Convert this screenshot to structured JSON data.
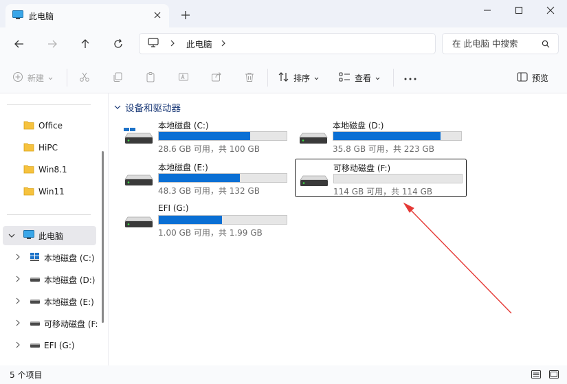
{
  "window": {
    "tab_title": "此电脑",
    "minimize_icon": "minimize-icon",
    "maximize_icon": "maximize-icon",
    "close_icon": "close-icon"
  },
  "address": {
    "crumb": "此电脑",
    "search_placeholder": "在 此电脑 中搜索"
  },
  "toolbar": {
    "new_label": "新建",
    "sort_label": "排序",
    "view_label": "查看",
    "preview_label": "预览"
  },
  "nav": {
    "items": [
      {
        "label": "Office",
        "icon": "folder-icon"
      },
      {
        "label": "HiPC",
        "icon": "folder-icon"
      },
      {
        "label": "Win8.1",
        "icon": "folder-icon"
      },
      {
        "label": "Win11",
        "icon": "folder-icon"
      },
      {
        "label": "此电脑",
        "icon": "pc-icon"
      },
      {
        "label": "本地磁盘 (C:)",
        "icon": "windows-drive-icon"
      },
      {
        "label": "本地磁盘 (D:)",
        "icon": "drive-icon"
      },
      {
        "label": "本地磁盘 (E:)",
        "icon": "drive-icon"
      },
      {
        "label": "可移动磁盘 (F:",
        "icon": "drive-icon"
      },
      {
        "label": "EFI (G:)",
        "icon": "drive-icon"
      }
    ]
  },
  "section": {
    "title": "设备和驱动器"
  },
  "drives": [
    {
      "name": "本地磁盘 (C:)",
      "info": "28.6 GB 可用，共 100 GB",
      "used_fraction": 0.714
    },
    {
      "name": "本地磁盘 (D:)",
      "info": "35.8 GB 可用，共 223 GB",
      "used_fraction": 0.84
    },
    {
      "name": "本地磁盘 (E:)",
      "info": "48.3 GB 可用，共 132 GB",
      "used_fraction": 0.634
    },
    {
      "name": "可移动磁盘 (F:)",
      "info": "114 GB 可用，共 114 GB",
      "used_fraction": 0.0
    },
    {
      "name": "EFI (G:)",
      "info": "1.00 GB 可用，共 1.99 GB",
      "used_fraction": 0.497
    }
  ],
  "status": {
    "count": "5 个项目"
  },
  "colors": {
    "accent": "#0a6fd4",
    "annotation_arrow": "#e53935"
  }
}
